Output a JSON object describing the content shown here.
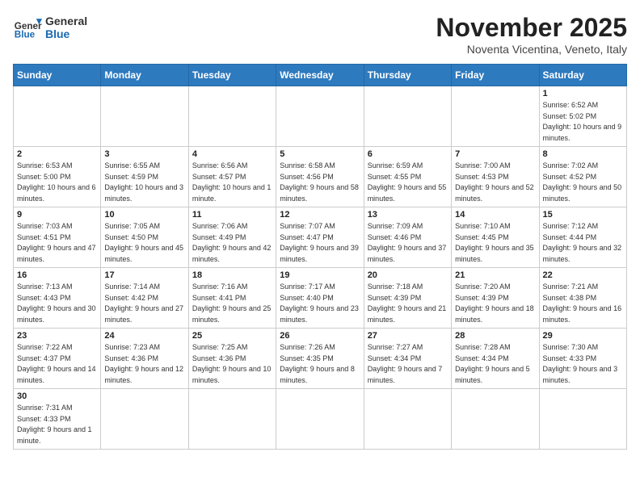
{
  "header": {
    "logo_general": "General",
    "logo_blue": "Blue",
    "month_title": "November 2025",
    "location": "Noventa Vicentina, Veneto, Italy"
  },
  "weekdays": [
    "Sunday",
    "Monday",
    "Tuesday",
    "Wednesday",
    "Thursday",
    "Friday",
    "Saturday"
  ],
  "weeks": [
    [
      {
        "day": "",
        "info": ""
      },
      {
        "day": "",
        "info": ""
      },
      {
        "day": "",
        "info": ""
      },
      {
        "day": "",
        "info": ""
      },
      {
        "day": "",
        "info": ""
      },
      {
        "day": "",
        "info": ""
      },
      {
        "day": "1",
        "info": "Sunrise: 6:52 AM\nSunset: 5:02 PM\nDaylight: 10 hours and 9 minutes."
      }
    ],
    [
      {
        "day": "2",
        "info": "Sunrise: 6:53 AM\nSunset: 5:00 PM\nDaylight: 10 hours and 6 minutes."
      },
      {
        "day": "3",
        "info": "Sunrise: 6:55 AM\nSunset: 4:59 PM\nDaylight: 10 hours and 3 minutes."
      },
      {
        "day": "4",
        "info": "Sunrise: 6:56 AM\nSunset: 4:57 PM\nDaylight: 10 hours and 1 minute."
      },
      {
        "day": "5",
        "info": "Sunrise: 6:58 AM\nSunset: 4:56 PM\nDaylight: 9 hours and 58 minutes."
      },
      {
        "day": "6",
        "info": "Sunrise: 6:59 AM\nSunset: 4:55 PM\nDaylight: 9 hours and 55 minutes."
      },
      {
        "day": "7",
        "info": "Sunrise: 7:00 AM\nSunset: 4:53 PM\nDaylight: 9 hours and 52 minutes."
      },
      {
        "day": "8",
        "info": "Sunrise: 7:02 AM\nSunset: 4:52 PM\nDaylight: 9 hours and 50 minutes."
      }
    ],
    [
      {
        "day": "9",
        "info": "Sunrise: 7:03 AM\nSunset: 4:51 PM\nDaylight: 9 hours and 47 minutes."
      },
      {
        "day": "10",
        "info": "Sunrise: 7:05 AM\nSunset: 4:50 PM\nDaylight: 9 hours and 45 minutes."
      },
      {
        "day": "11",
        "info": "Sunrise: 7:06 AM\nSunset: 4:49 PM\nDaylight: 9 hours and 42 minutes."
      },
      {
        "day": "12",
        "info": "Sunrise: 7:07 AM\nSunset: 4:47 PM\nDaylight: 9 hours and 39 minutes."
      },
      {
        "day": "13",
        "info": "Sunrise: 7:09 AM\nSunset: 4:46 PM\nDaylight: 9 hours and 37 minutes."
      },
      {
        "day": "14",
        "info": "Sunrise: 7:10 AM\nSunset: 4:45 PM\nDaylight: 9 hours and 35 minutes."
      },
      {
        "day": "15",
        "info": "Sunrise: 7:12 AM\nSunset: 4:44 PM\nDaylight: 9 hours and 32 minutes."
      }
    ],
    [
      {
        "day": "16",
        "info": "Sunrise: 7:13 AM\nSunset: 4:43 PM\nDaylight: 9 hours and 30 minutes."
      },
      {
        "day": "17",
        "info": "Sunrise: 7:14 AM\nSunset: 4:42 PM\nDaylight: 9 hours and 27 minutes."
      },
      {
        "day": "18",
        "info": "Sunrise: 7:16 AM\nSunset: 4:41 PM\nDaylight: 9 hours and 25 minutes."
      },
      {
        "day": "19",
        "info": "Sunrise: 7:17 AM\nSunset: 4:40 PM\nDaylight: 9 hours and 23 minutes."
      },
      {
        "day": "20",
        "info": "Sunrise: 7:18 AM\nSunset: 4:39 PM\nDaylight: 9 hours and 21 minutes."
      },
      {
        "day": "21",
        "info": "Sunrise: 7:20 AM\nSunset: 4:39 PM\nDaylight: 9 hours and 18 minutes."
      },
      {
        "day": "22",
        "info": "Sunrise: 7:21 AM\nSunset: 4:38 PM\nDaylight: 9 hours and 16 minutes."
      }
    ],
    [
      {
        "day": "23",
        "info": "Sunrise: 7:22 AM\nSunset: 4:37 PM\nDaylight: 9 hours and 14 minutes."
      },
      {
        "day": "24",
        "info": "Sunrise: 7:23 AM\nSunset: 4:36 PM\nDaylight: 9 hours and 12 minutes."
      },
      {
        "day": "25",
        "info": "Sunrise: 7:25 AM\nSunset: 4:36 PM\nDaylight: 9 hours and 10 minutes."
      },
      {
        "day": "26",
        "info": "Sunrise: 7:26 AM\nSunset: 4:35 PM\nDaylight: 9 hours and 8 minutes."
      },
      {
        "day": "27",
        "info": "Sunrise: 7:27 AM\nSunset: 4:34 PM\nDaylight: 9 hours and 7 minutes."
      },
      {
        "day": "28",
        "info": "Sunrise: 7:28 AM\nSunset: 4:34 PM\nDaylight: 9 hours and 5 minutes."
      },
      {
        "day": "29",
        "info": "Sunrise: 7:30 AM\nSunset: 4:33 PM\nDaylight: 9 hours and 3 minutes."
      }
    ],
    [
      {
        "day": "30",
        "info": "Sunrise: 7:31 AM\nSunset: 4:33 PM\nDaylight: 9 hours and 1 minute."
      },
      {
        "day": "",
        "info": ""
      },
      {
        "day": "",
        "info": ""
      },
      {
        "day": "",
        "info": ""
      },
      {
        "day": "",
        "info": ""
      },
      {
        "day": "",
        "info": ""
      },
      {
        "day": "",
        "info": ""
      }
    ]
  ]
}
